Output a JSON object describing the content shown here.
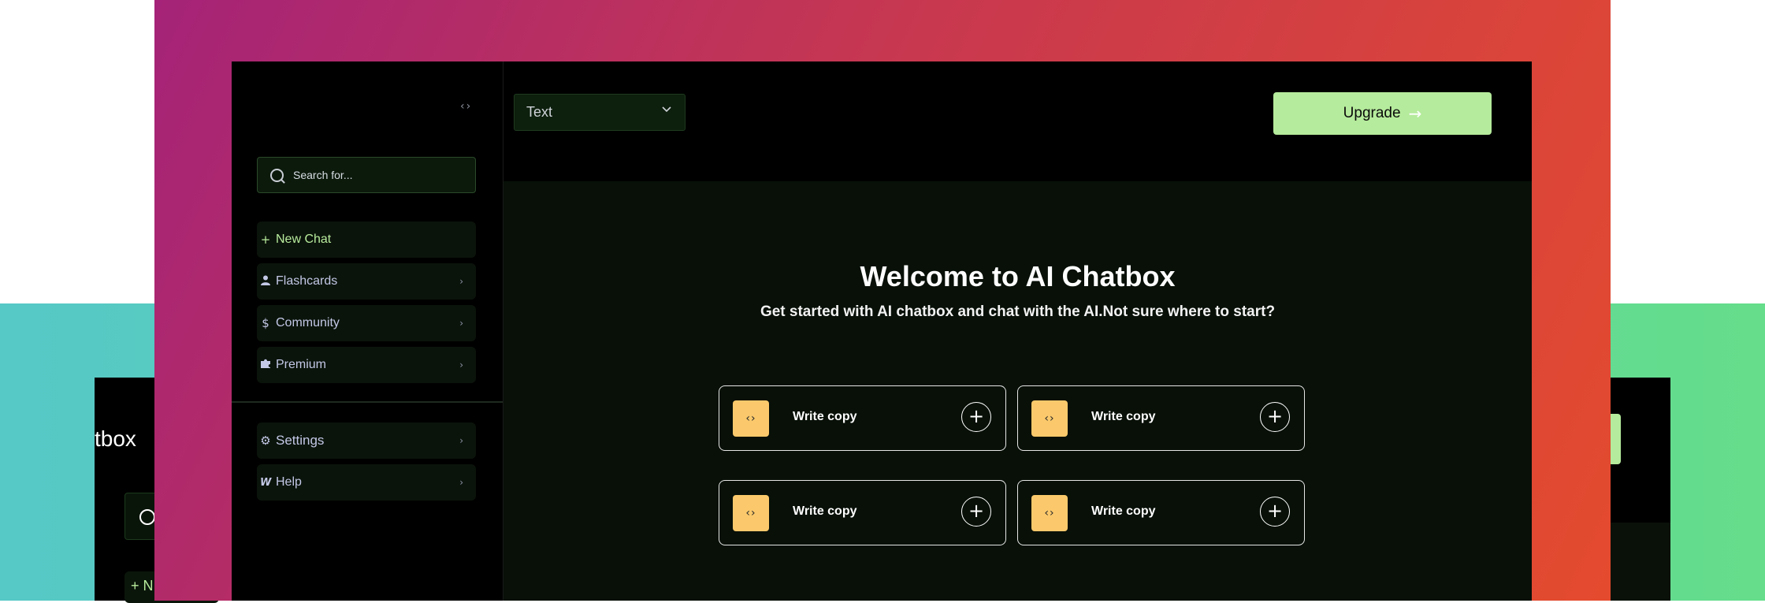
{
  "background_window": {
    "title_fragment": "tbox",
    "new_chat_fragment": "+ N"
  },
  "sidebar": {
    "collapse_icon": "‹›",
    "search": {
      "placeholder": "Search for..."
    },
    "items": [
      {
        "label": "New Chat",
        "icon": "+"
      },
      {
        "label": "Flashcards",
        "icon": "person-icon"
      },
      {
        "label": "Community",
        "icon": "dollar-icon"
      },
      {
        "label": "Premium",
        "icon": "puzzle-icon"
      }
    ],
    "bottom_items": [
      {
        "label": "Settings",
        "icon": "gear-icon"
      },
      {
        "label": "Help",
        "icon": "w-logo-icon"
      }
    ]
  },
  "topbar": {
    "mode_select": {
      "value": "Text"
    },
    "upgrade_label": "Upgrade"
  },
  "main": {
    "title": "Welcome to AI Chatbox",
    "subtitle": "Get started with AI chatbox and chat with the AI.Not sure where to start?",
    "cards": [
      {
        "label": "Write copy"
      },
      {
        "label": "Write copy"
      },
      {
        "label": "Write copy"
      },
      {
        "label": "Write copy"
      }
    ]
  },
  "colors": {
    "accent_green": "#b5eb9c",
    "badge_yellow": "#fbc96b",
    "gradient_start": "#a52378",
    "gradient_end": "#e44b2e"
  }
}
